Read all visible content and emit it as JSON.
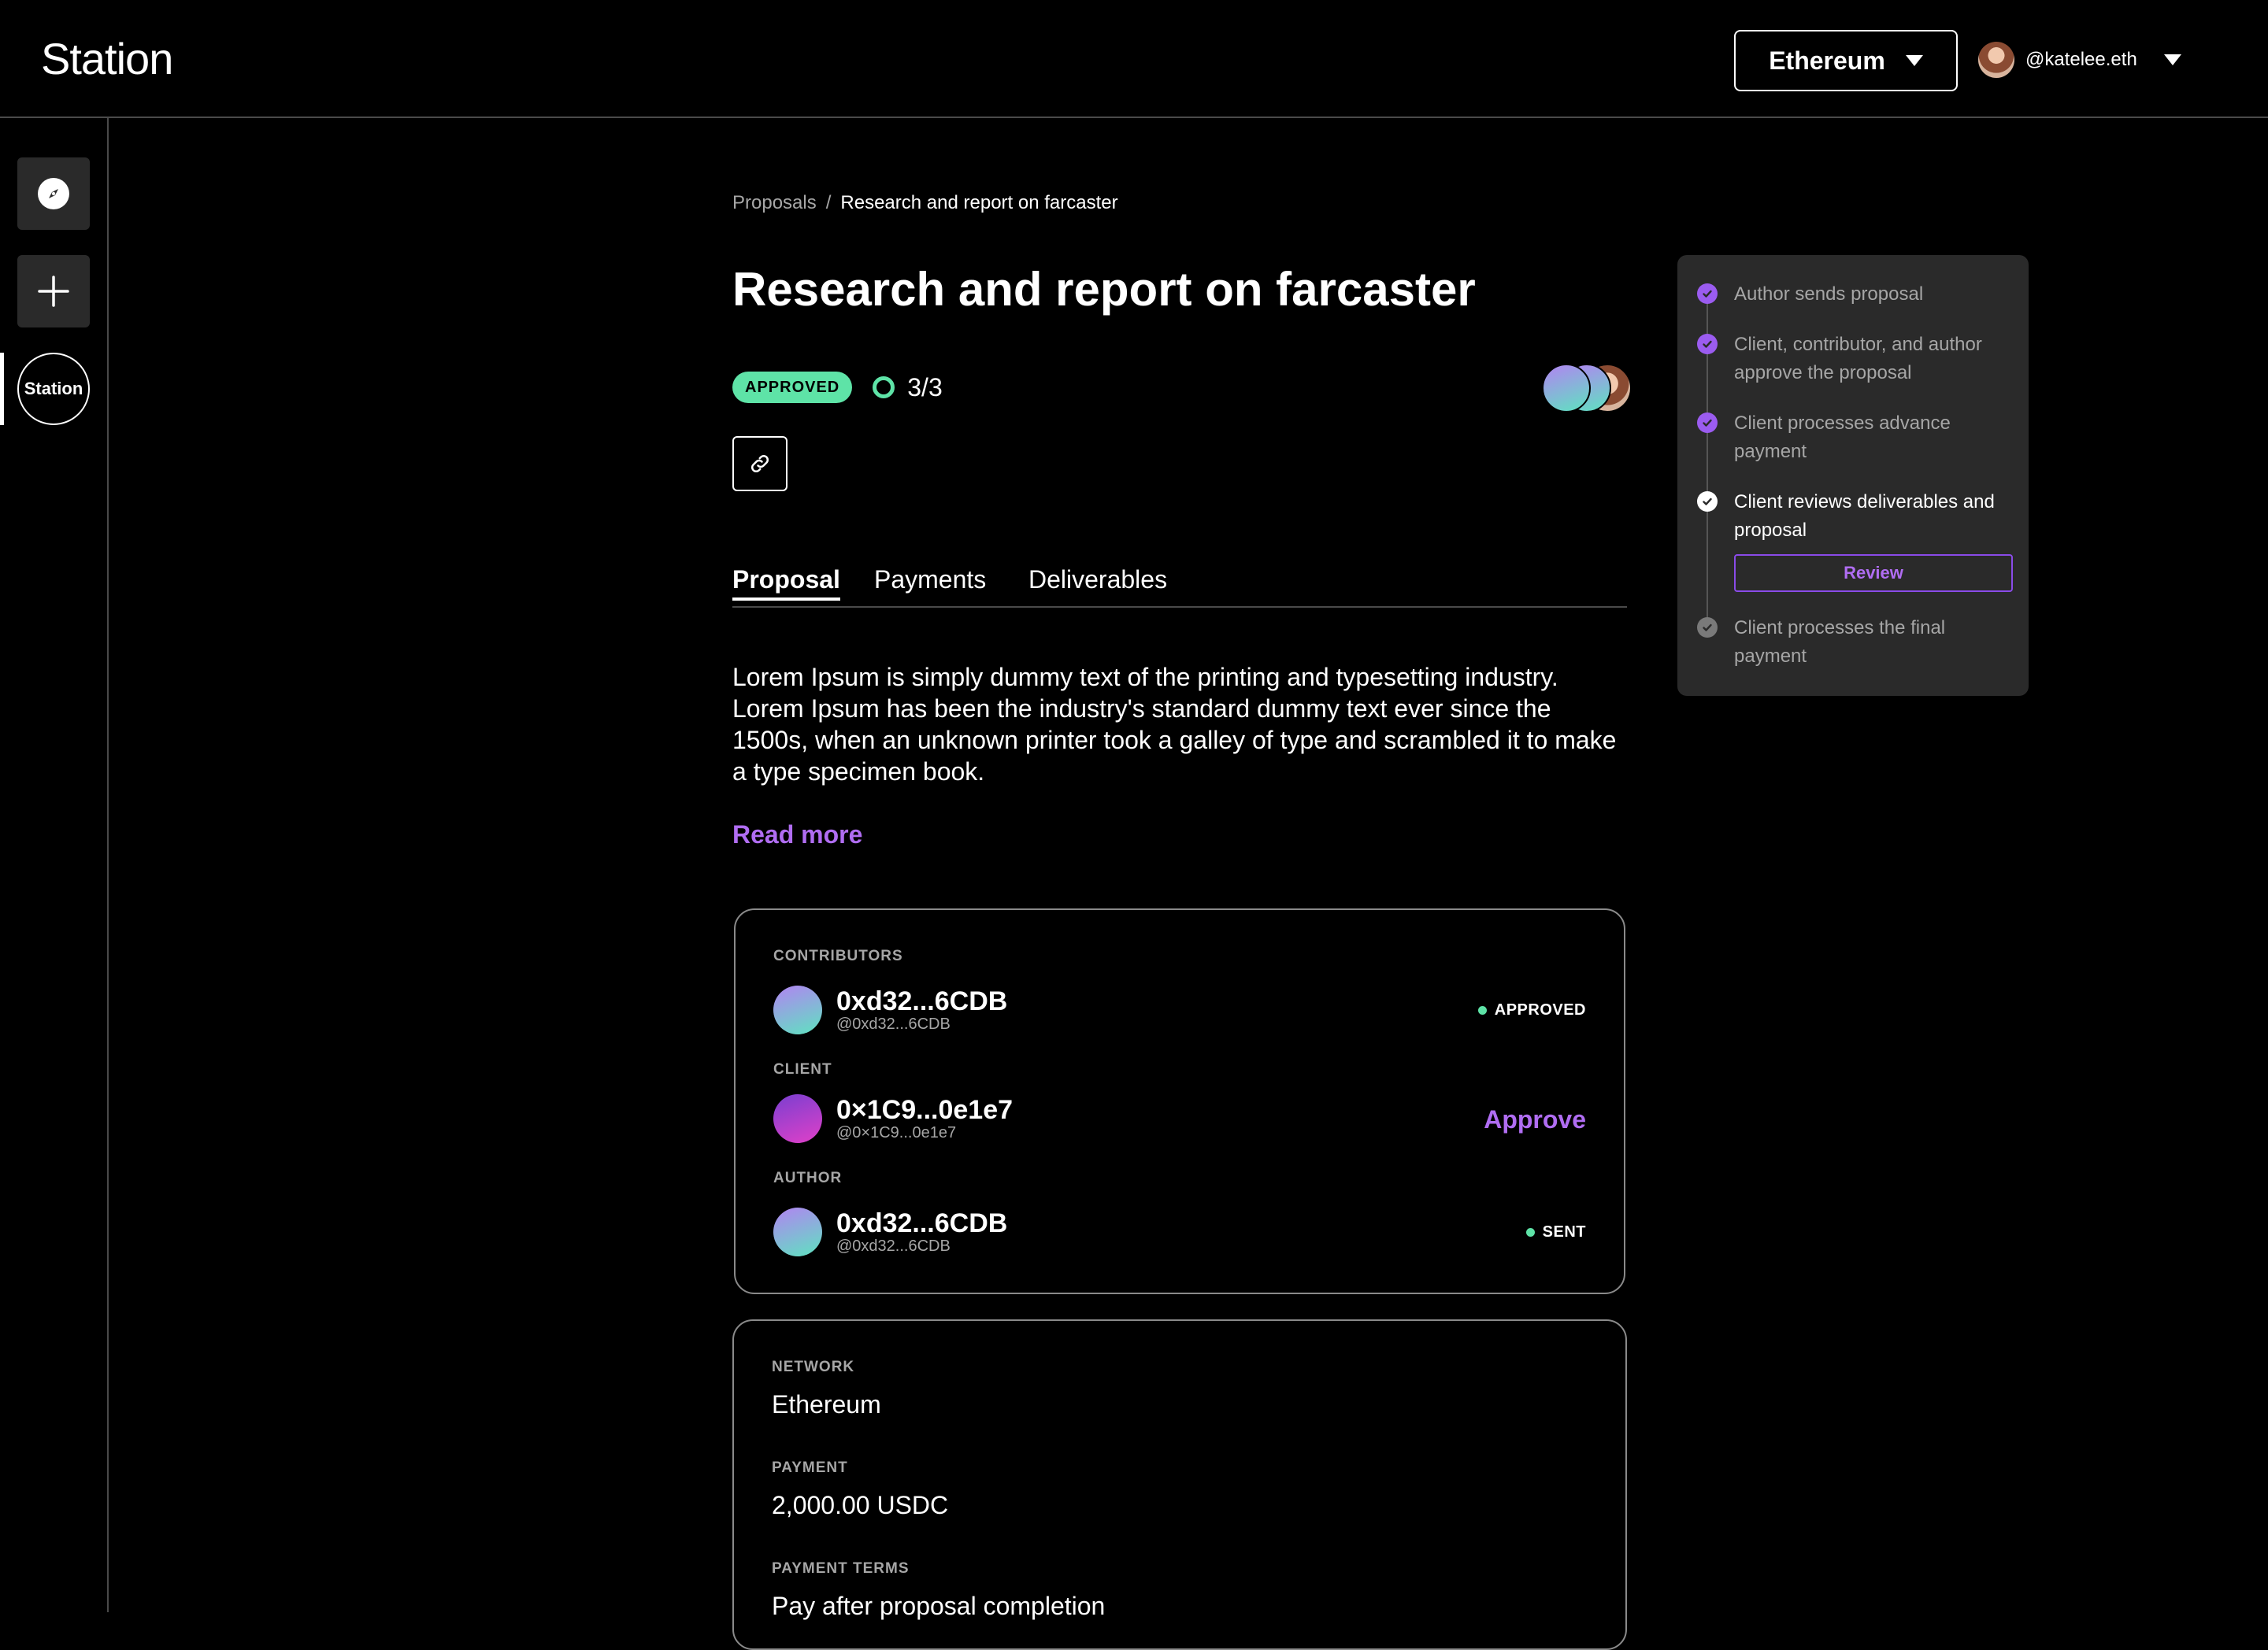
{
  "app": {
    "logo": "Station"
  },
  "header": {
    "network": "Ethereum",
    "user": "@katelee.eth"
  },
  "rail": {
    "station_label": "Station"
  },
  "breadcrumb": {
    "parent": "Proposals",
    "separator": "/",
    "current": "Research and report on farcaster"
  },
  "proposal": {
    "title": "Research and report on farcaster",
    "status": "APPROVED",
    "approvals": "3/3",
    "description": "Lorem Ipsum is simply dummy text of the printing and typesetting industry. Lorem Ipsum has been the industry's standard dummy text ever since the 1500s, when an unknown printer took a galley of type and scrambled it to make a type specimen book.",
    "read_more": "Read more"
  },
  "tabs": [
    {
      "label": "Proposal",
      "active": true
    },
    {
      "label": "Payments",
      "active": false
    },
    {
      "label": "Deliverables",
      "active": false
    }
  ],
  "participants": [
    {
      "role": "CONTRIBUTORS",
      "name": "0xd32...6CDB",
      "handle": "@0xd32...6CDB",
      "status": "APPROVED"
    },
    {
      "role": "CLIENT",
      "name": "0×1C9...0e1e7",
      "handle": "@0×1C9...0e1e7",
      "action": "Approve"
    },
    {
      "role": "AUTHOR",
      "name": "0xd32...6CDB",
      "handle": "@0xd32...6CDB",
      "status": "SENT"
    }
  ],
  "details": [
    {
      "label": "NETWORK",
      "value": "Ethereum"
    },
    {
      "label": "PAYMENT",
      "value": "2,000.00 USDC"
    },
    {
      "label": "PAYMENT TERMS",
      "value": "Pay after proposal completion"
    }
  ],
  "timeline": {
    "steps": [
      {
        "text": "Author sends proposal",
        "state": "done"
      },
      {
        "text": "Client, contributor, and author approve the proposal",
        "state": "done"
      },
      {
        "text": "Client processes advance payment",
        "state": "done"
      },
      {
        "text": "Client reviews deliverables and proposal",
        "state": "current"
      },
      {
        "text": "Client processes the final payment",
        "state": "pending"
      }
    ],
    "review_button": "Review"
  },
  "colors": {
    "accent_purple": "#b06df2",
    "approved_green": "#5ee3a7",
    "panel_bg": "#2a2a2a",
    "background": "#000000"
  },
  "icons": [
    "compass-icon",
    "plus-icon",
    "link-icon",
    "chevron-down-icon",
    "check-icon"
  ]
}
